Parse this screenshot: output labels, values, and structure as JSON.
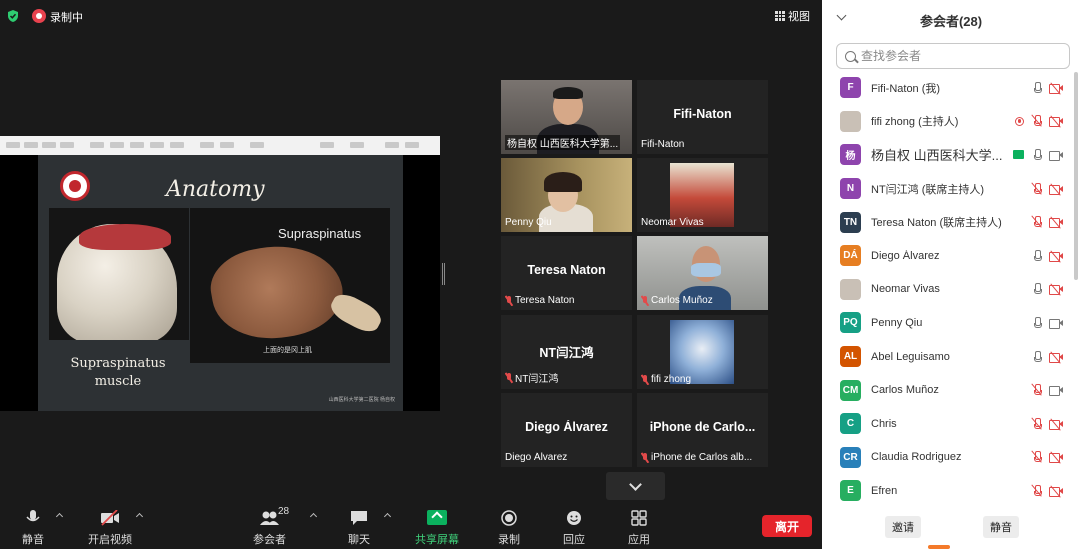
{
  "topbar": {
    "recording_label": "录制中",
    "view_label": "视图"
  },
  "slide": {
    "title": "Anatomy",
    "muscle_label": "Supraspinatus",
    "muscle_caption": "上面的是冈上肌",
    "caption_line1": "Supraspinatus",
    "caption_line2": "muscle",
    "footer": "山西医科大学第二医院 杨自权"
  },
  "tiles": [
    {
      "id": "yang",
      "label": "杨自权 山西医科大学第...",
      "muted": false,
      "active": true
    },
    {
      "id": "fifi-naton",
      "name": "Fifi-Naton",
      "label": "Fifi-Naton",
      "muted": false
    },
    {
      "id": "penny",
      "label": "Penny Qiu",
      "muted": false
    },
    {
      "id": "neomar",
      "label": "Neomar Vivas",
      "muted": false
    },
    {
      "id": "teresa",
      "name": "Teresa  Naton",
      "label": "Teresa  Naton",
      "muted": true
    },
    {
      "id": "carlos",
      "label": "Carlos Muñoz",
      "muted": true
    },
    {
      "id": "nt",
      "name": "NT闫江鸿",
      "label": "NT闫江鸿",
      "muted": true
    },
    {
      "id": "fifi-zhong",
      "label": "fifi zhong",
      "muted": true
    },
    {
      "id": "diego",
      "name": "Diego Álvarez",
      "label": "Diego Álvarez",
      "muted": false
    },
    {
      "id": "iphone",
      "name": "iPhone de Carlo...",
      "label": "iPhone de Carlos alb...",
      "muted": true
    }
  ],
  "toolbar": {
    "mute": "静音",
    "start_video": "开启视频",
    "participants": "参会者",
    "participants_count": "28",
    "chat": "聊天",
    "share_screen": "共享屏幕",
    "record": "录制",
    "reactions": "回应",
    "apps": "应用",
    "leave": "离开"
  },
  "panel": {
    "title": "参会者(28)",
    "search_placeholder": "查找参会者",
    "participants": [
      {
        "initials": "F",
        "name": "Fifi-Naton (我)",
        "color": "#8e44ad",
        "mic": "on",
        "cam": "off"
      },
      {
        "initials": "",
        "name": "fifi zhong (主持人)",
        "color": "#c9c0b6",
        "photo": true,
        "rec": true,
        "mic": "off",
        "cam": "off"
      },
      {
        "initials": "杨",
        "name": "杨自权 山西医科大学...",
        "color": "#8e44ad",
        "big": true,
        "share": true,
        "mic": "on",
        "cam": "on"
      },
      {
        "initials": "N",
        "name": "NT闫江鸿 (联席主持人)",
        "color": "#8e44ad",
        "mic": "off",
        "cam": "off"
      },
      {
        "initials": "TN",
        "name": "Teresa  Naton (联席主持人)",
        "color": "#2c3e50",
        "mic": "off",
        "cam": "off"
      },
      {
        "initials": "DÁ",
        "name": "Diego Álvarez",
        "color": "#e67e22",
        "mic": "on",
        "cam": "off"
      },
      {
        "initials": "",
        "name": "Neomar Vivas",
        "color": "#c9c0b6",
        "photo": true,
        "mic": "on",
        "cam": "off"
      },
      {
        "initials": "PQ",
        "name": "Penny Qiu",
        "color": "#16a085",
        "mic": "on",
        "cam": "on"
      },
      {
        "initials": "AL",
        "name": "Abel Leguisamo",
        "color": "#d35400",
        "mic": "on",
        "cam": "off"
      },
      {
        "initials": "CM",
        "name": "Carlos Muñoz",
        "color": "#27ae60",
        "mic": "off",
        "cam": "on"
      },
      {
        "initials": "C",
        "name": "Chris",
        "color": "#16a085",
        "mic": "off",
        "cam": "off"
      },
      {
        "initials": "CR",
        "name": "Claudia Rodriguez",
        "color": "#2980b9",
        "mic": "off",
        "cam": "off"
      },
      {
        "initials": "E",
        "name": "Efren",
        "color": "#27ae60",
        "mic": "off",
        "cam": "off"
      }
    ],
    "invite_label": "邀请",
    "mute_all_label": "静音"
  }
}
